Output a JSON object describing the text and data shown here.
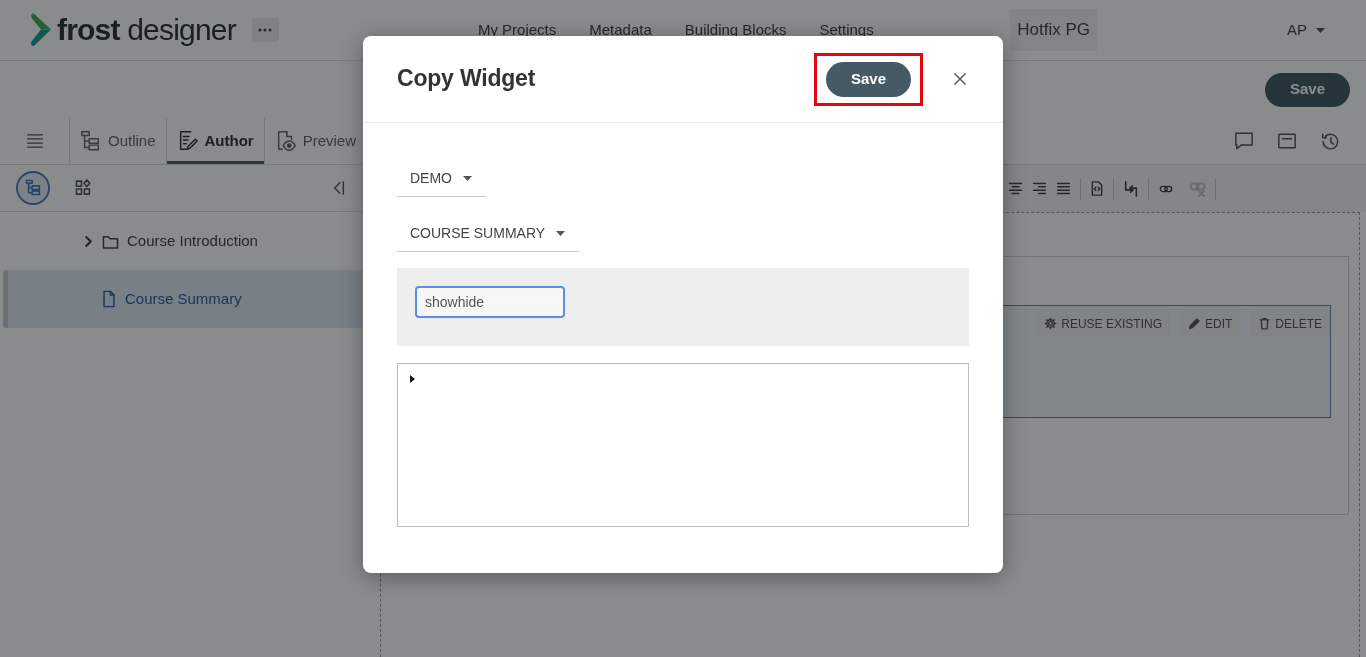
{
  "app_bar": {
    "logo": "**frost** designer",
    "nav_links": [
      {
        "label": "My Projects"
      },
      {
        "label": "Metadata"
      },
      {
        "label": "Building Blocks"
      },
      {
        "label": "Settings"
      }
    ],
    "project": "Hotfix PG",
    "user": "AP"
  },
  "action_bar": {
    "save_button": "Save"
  },
  "tabs": [
    {
      "kind": "outline",
      "label": "Outline",
      "selected": false
    },
    {
      "kind": "author",
      "label": "Author",
      "selected": true
    },
    {
      "kind": "preview",
      "label": "Preview",
      "selected": false
    }
  ],
  "sidebar": {
    "views": [
      {
        "kind": "tree",
        "selected": true
      },
      {
        "kind": "blocks",
        "selected": false
      }
    ],
    "tree": [
      {
        "kind": "folder",
        "label": "Course Introduction",
        "expanded": false,
        "selected": false
      },
      {
        "kind": "page",
        "label": "Course Summary",
        "selected": true
      }
    ]
  },
  "editor": {
    "widget_actions": [
      {
        "kind": "reuse",
        "label": "REUSE EXISTING"
      },
      {
        "kind": "edit",
        "label": "EDIT"
      },
      {
        "kind": "delete",
        "label": "DELETE"
      }
    ]
  },
  "dialog": {
    "title": "Copy Widget",
    "save_button": {
      "label": "Save",
      "highlighted": true
    },
    "selects": [
      {
        "label": "DEMO"
      },
      {
        "label": "COURSE SUMMARY"
      }
    ],
    "search": {
      "value": "showhide",
      "focused": true
    },
    "tree": {
      "expanded": false
    }
  }
}
